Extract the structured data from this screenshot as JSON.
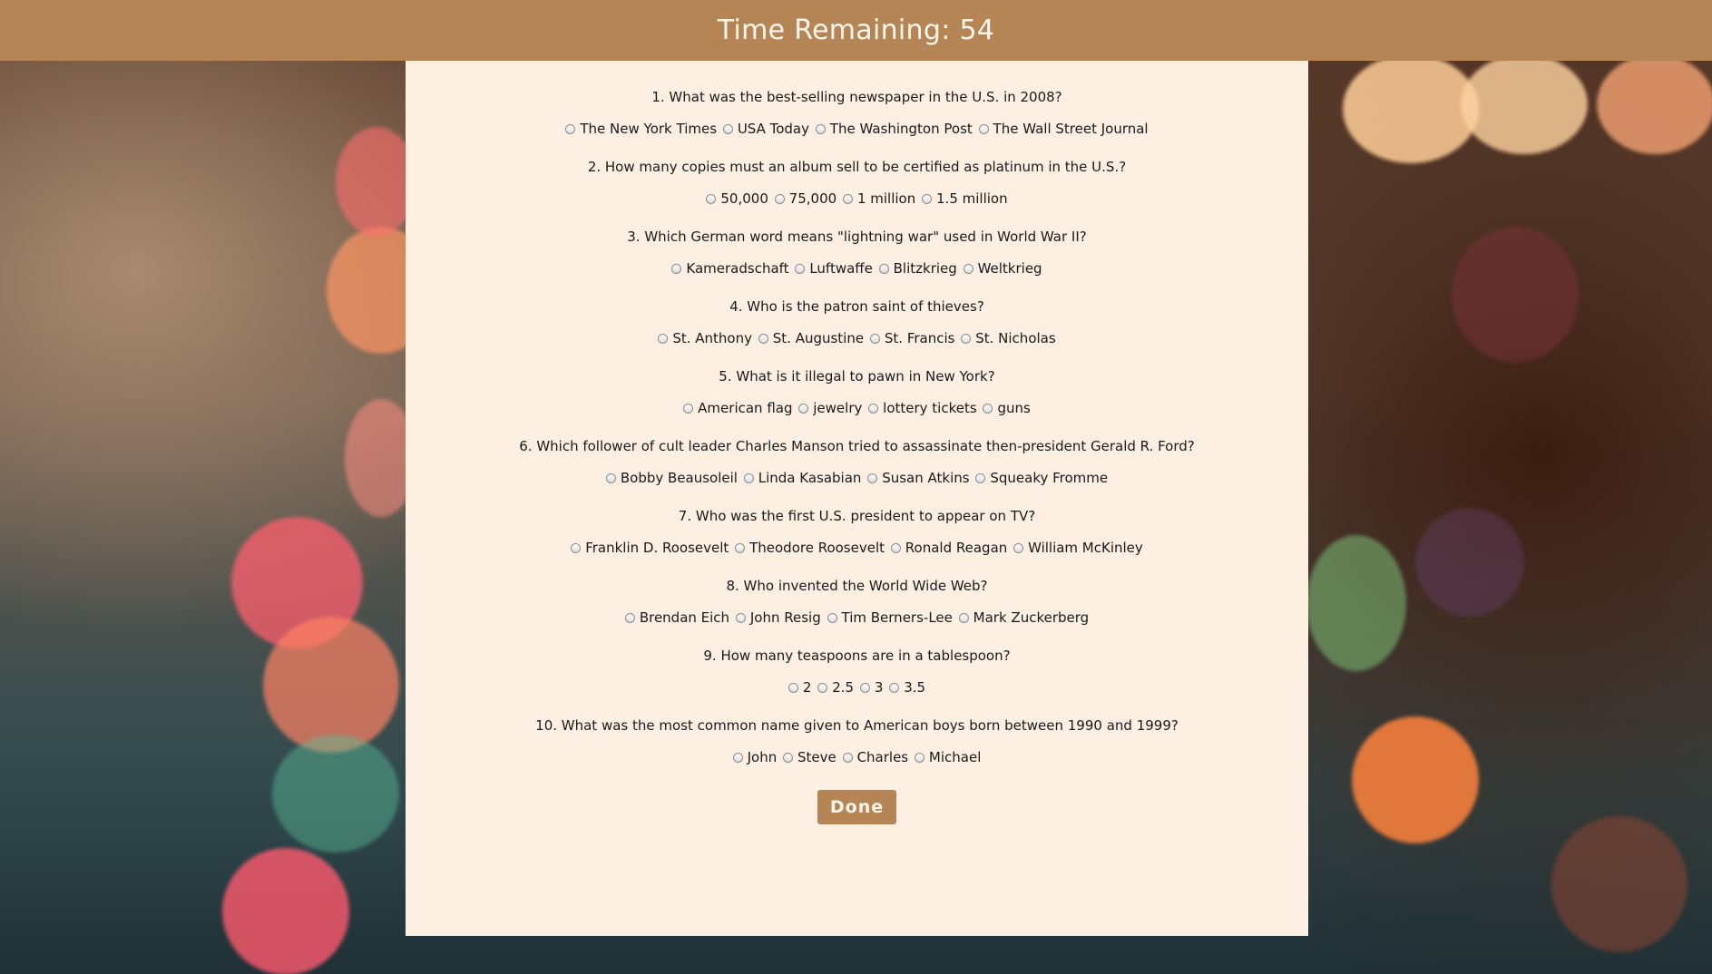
{
  "header": {
    "label": "Time Remaining:",
    "seconds": "54"
  },
  "questions": [
    {
      "text": "1. What was the best-selling newspaper in the U.S. in 2008?",
      "options": [
        "The New York Times",
        "USA Today",
        "The Washington Post",
        "The Wall Street Journal"
      ]
    },
    {
      "text": "2. How many copies must an album sell to be certified as platinum in the U.S.?",
      "options": [
        "50,000",
        "75,000",
        "1 million",
        "1.5 million"
      ]
    },
    {
      "text": "3. Which German word means \"lightning war\" used in World War II?",
      "options": [
        "Kameradschaft",
        "Luftwaffe",
        "Blitzkrieg",
        "Weltkrieg"
      ]
    },
    {
      "text": "4. Who is the patron saint of thieves?",
      "options": [
        "St. Anthony",
        "St. Augustine",
        "St. Francis",
        "St. Nicholas"
      ]
    },
    {
      "text": "5. What is it illegal to pawn in New York?",
      "options": [
        "American flag",
        "jewelry",
        "lottery tickets",
        "guns"
      ]
    },
    {
      "text": "6. Which follower of cult leader Charles Manson tried to assassinate then-president Gerald R. Ford?",
      "options": [
        "Bobby Beausoleil",
        "Linda Kasabian",
        "Susan Atkins",
        "Squeaky Fromme"
      ]
    },
    {
      "text": "7. Who was the first U.S. president to appear on TV?",
      "options": [
        "Franklin D. Roosevelt",
        "Theodore Roosevelt",
        "Ronald Reagan",
        "William McKinley"
      ]
    },
    {
      "text": "8. Who invented the World Wide Web?",
      "options": [
        "Brendan Eich",
        "John Resig",
        "Tim Berners-Lee",
        "Mark Zuckerberg"
      ]
    },
    {
      "text": "9. How many teaspoons are in a tablespoon?",
      "options": [
        "2",
        "2.5",
        "3",
        "3.5"
      ]
    },
    {
      "text": "10. What was the most common name given to American boys born between 1990 and 1999?",
      "options": [
        "John",
        "Steve",
        "Charles",
        "Michael"
      ]
    }
  ],
  "done_label": "Done",
  "colors": {
    "header_bg": "#b58555",
    "panel_bg": "#fdf0e3",
    "button_bg": "#b58555"
  }
}
